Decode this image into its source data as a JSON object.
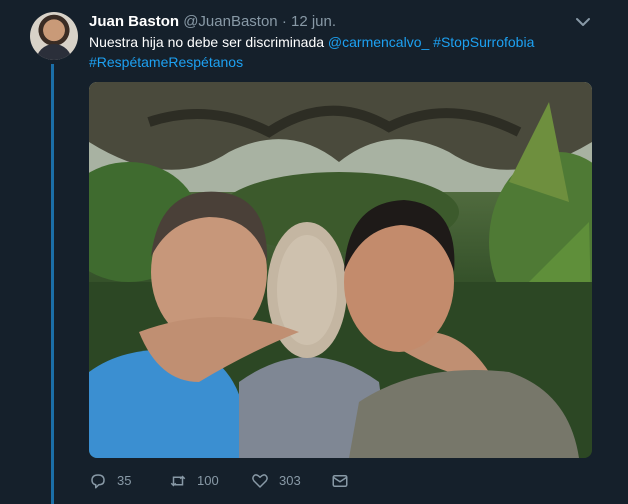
{
  "tweet": {
    "author_name": "Juan Baston",
    "handle": "@JuanBaston",
    "separator": "·",
    "date": "12 jun.",
    "text_plain": "Nuestra hija no debe ser discriminada",
    "mention": "@carmencalvo_",
    "hashtag_1": "#StopSurrofobia",
    "hashtag_2": "#RespétameRespétanos"
  },
  "actions": {
    "reply_count": "35",
    "retweet_count": "100",
    "like_count": "303"
  },
  "icons": {
    "menu": "chevron-down-icon",
    "reply": "reply-icon",
    "retweet": "retweet-icon",
    "like": "heart-icon",
    "dm": "envelope-icon"
  },
  "colors": {
    "background": "#15202b",
    "link": "#1da1f2",
    "muted": "#8899a6",
    "thread_line": "#1b6fa8"
  }
}
